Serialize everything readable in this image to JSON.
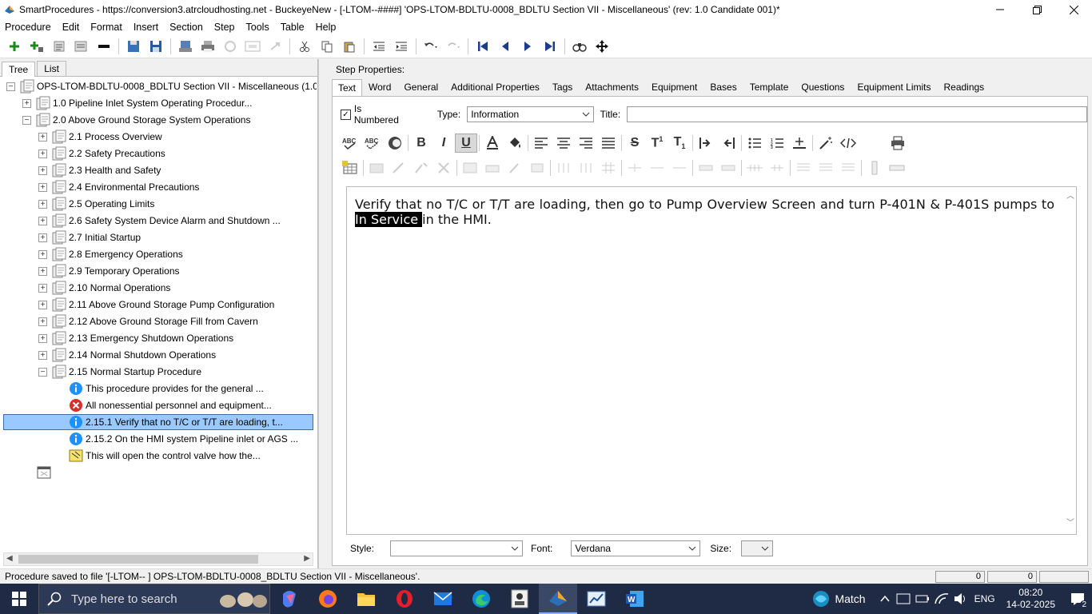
{
  "window": {
    "title": "SmartProcedures - https://conversion3.atrcloudhosting.net - BuckeyeNew - [-LTOM--####] 'OPS-LTOM-BDLTU-0008_BDLTU Section VII - Miscellaneous' (rev: 1.0 Candidate 001)*"
  },
  "menu": {
    "items": [
      "Procedure",
      "Edit",
      "Format",
      "Insert",
      "Section",
      "Step",
      "Tools",
      "Table",
      "Help"
    ]
  },
  "left_tabs": [
    "Tree",
    "List"
  ],
  "tree": {
    "root": "OPS-LTOM-BDLTU-0008_BDLTU Section VII - Miscellaneous (1.0...",
    "sections": [
      {
        "label": "1.0 Pipeline Inlet System Operating Procedur...",
        "expander": "+"
      },
      {
        "label": "2.0 Above Ground Storage System Operations",
        "expander": "−"
      }
    ],
    "subsections": [
      "2.1 Process Overview",
      "2.2 Safety Precautions",
      "2.3 Health and Safety",
      "2.4 Environmental Precautions",
      "2.5 Operating Limits",
      "2.6 Safety System Device Alarm and Shutdown ...",
      "2.7 Initial Startup",
      "2.8 Emergency Operations",
      "2.9 Temporary Operations",
      "2.10 Normal Operations",
      "2.11 Above Ground Storage Pump Configuration",
      "2.12 Above Ground Storage Fill from Cavern",
      "2.13 Emergency Shutdown Operations",
      "2.14 Normal Shutdown Operations",
      "2.15 Normal Startup Procedure"
    ],
    "steps": [
      {
        "label": "This procedure provides for the general ...",
        "icon": "info-icon"
      },
      {
        "label": "All nonessential personnel and equipment...",
        "icon": "warning-x-icon"
      },
      {
        "label": "2.15.1 Verify that no T/C or T/T are loading, t...",
        "icon": "info-icon",
        "selected": true
      },
      {
        "label": "2.15.2 On the HMI system Pipeline inlet or AGS ...",
        "icon": "info-icon"
      },
      {
        "label": "This will open the control valve how the...",
        "icon": "note-icon"
      }
    ]
  },
  "step_properties": {
    "label": "Step Properties:",
    "tabs": [
      "Text",
      "Word",
      "General",
      "Additional Properties",
      "Tags",
      "Attachments",
      "Equipment",
      "Bases",
      "Template",
      "Questions",
      "Equipment Limits",
      "Readings"
    ],
    "is_numbered_label": "Is Numbered",
    "type_label": "Type:",
    "type_value": "Information",
    "title_label": "Title:",
    "title_value": ""
  },
  "editor": {
    "text_before": "Verify that no T/C or T/T are loading, then go to Pump Overview Screen and turn P-401N & P-401S pumps to ",
    "text_highlight": "In Service ",
    "text_after": "in the HMI."
  },
  "bottom": {
    "style_label": "Style:",
    "style_value": "",
    "font_label": "Font:",
    "font_value": "Verdana",
    "size_label": "Size:",
    "size_value": ""
  },
  "status": {
    "message": "Procedure saved to file '[-LTOM--     ] OPS-LTOM-BDLTU-0008_BDLTU Section VII - Miscellaneous'.",
    "cell1": "0",
    "cell2": "0"
  },
  "taskbar": {
    "search_placeholder": "Type here to search",
    "weather": "Match",
    "lang": "ENG",
    "time": "08:20",
    "date": "14-02-2025",
    "notifications": "2"
  },
  "colors": {
    "selection": "#99c9ff",
    "taskbar": "#1f2a44",
    "info_blue": "#1e90ff",
    "error_red": "#d9302c"
  }
}
